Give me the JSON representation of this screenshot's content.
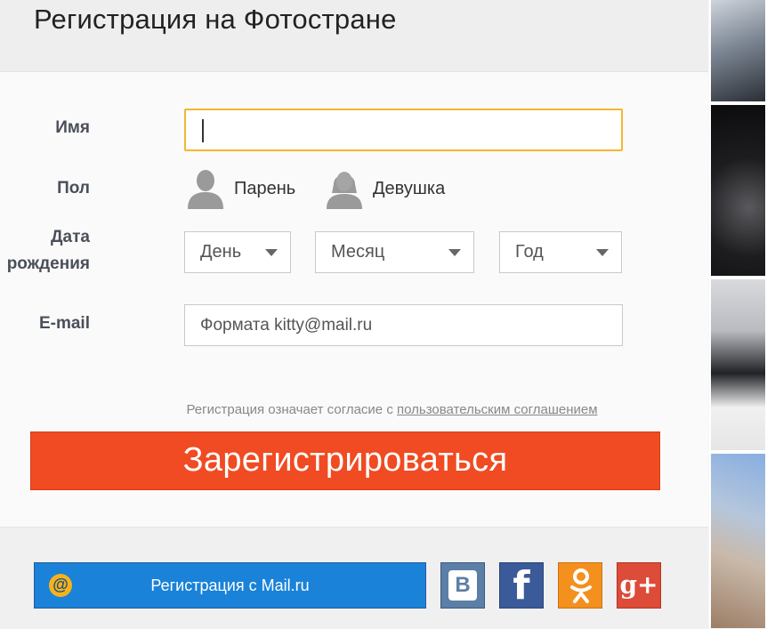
{
  "header": {
    "title": "Регистрация на Фотостране"
  },
  "form": {
    "name_label": "Имя",
    "gender_label": "Пол",
    "gender_options": [
      "Парень",
      "Девушка"
    ],
    "dob_label_line1": "Дата",
    "dob_label_line2": "рождения",
    "dob_selects": {
      "day": "День",
      "month": "Месяц",
      "year": "Год"
    },
    "email_label": "E-mail",
    "email_placeholder": "Формата kitty@mail.ru"
  },
  "agreement": {
    "text": "Регистрация означает согласие с",
    "link": "пользовательским соглашением"
  },
  "register_button": "Зарегистрироваться",
  "social": {
    "mail_button": "Регистрация с Mail.ru",
    "mail_icon": "@",
    "vk_icon": "В",
    "fb_icon": "f",
    "ok_icon": "ok",
    "gplus_icon": "g+"
  },
  "colors": {
    "accent": "#f04b22",
    "focus_border": "#f2b733",
    "mail_blue": "#1a82d9",
    "vk": "#5b7fa6",
    "facebook": "#3b5a9a",
    "odnoklassniki": "#f4901e",
    "google_plus": "#dd4b39"
  }
}
